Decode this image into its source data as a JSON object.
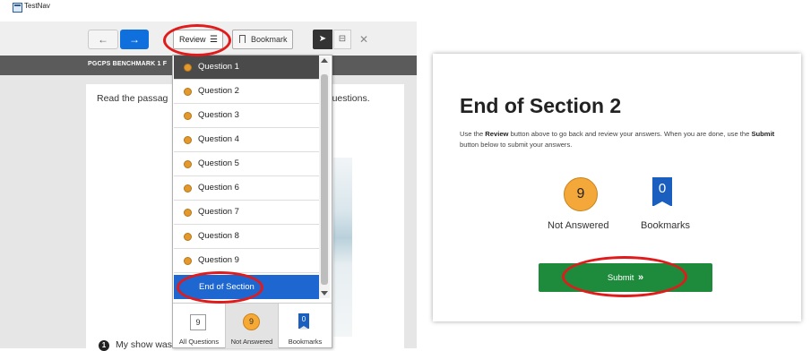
{
  "left": {
    "app_title": "TestNav",
    "toolbar": {
      "back_icon": "←",
      "next_icon": "→",
      "review_label": "Review",
      "review_icon": "☰",
      "bookmark_label": "Bookmark",
      "pointer_icon": "➤",
      "tool2_icon": "⊟",
      "close_icon": "✕"
    },
    "benchmark_title": "PGCPS BENCHMARK 1 F",
    "passage_instruction_start": "Read the passag",
    "passage_instruction_end": "e questions.",
    "paragraph_number": "1",
    "paragraph_text": "My show was",
    "review_menu": {
      "items": [
        {
          "label": "Question 1",
          "status": "not-answered",
          "selected": true
        },
        {
          "label": "Question 2",
          "status": "not-answered"
        },
        {
          "label": "Question 3",
          "status": "not-answered"
        },
        {
          "label": "Question 4",
          "status": "not-answered"
        },
        {
          "label": "Question 5",
          "status": "not-answered"
        },
        {
          "label": "Question 6",
          "status": "not-answered"
        },
        {
          "label": "Question 7",
          "status": "not-answered"
        },
        {
          "label": "Question 8",
          "status": "not-answered"
        },
        {
          "label": "Question 9",
          "status": "not-answered"
        }
      ],
      "end_section_label": "End of Section",
      "tabs": [
        {
          "label": "All Questions",
          "count": "9"
        },
        {
          "label": "Not Answered",
          "count": "9"
        },
        {
          "label": "Bookmarks",
          "count": "0"
        }
      ]
    }
  },
  "right": {
    "title": "End of Section 2",
    "instruction": {
      "part1": "Use the ",
      "review_word": "Review",
      "part2": " button above to go back and review your answers. When you are done, use the ",
      "submit_word": "Submit",
      "part3": " button below to submit your answers."
    },
    "not_answered_count": "9",
    "not_answered_label": "Not Answered",
    "bookmarks_count": "0",
    "bookmarks_label": "Bookmarks",
    "submit_label": "Submit",
    "submit_icon": "»"
  },
  "colors": {
    "accent_blue": "#1e66d0",
    "orange_status": "#f4a83a",
    "submit_green": "#1e8a3c",
    "annotation_red": "#e11b1b",
    "bookmark_blue": "#1a5fbf"
  }
}
